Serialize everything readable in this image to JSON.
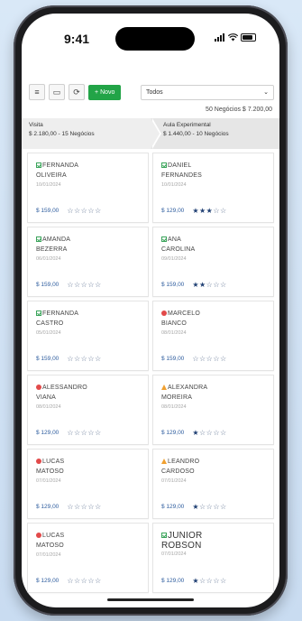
{
  "status_bar": {
    "time": "9:41"
  },
  "toolbar": {
    "icons": [
      "menu-icon",
      "window-icon",
      "refresh-icon"
    ],
    "novo_label": "Novo",
    "filter_value": "Todos"
  },
  "summary": "50 Negócios  $ 7.200,00",
  "stages": [
    {
      "title": "Visita",
      "detail": "$ 2.180,00 - 15 Negócios"
    },
    {
      "title": "Aula Experimental",
      "detail": "$ 1.440,00 - 10 Negócios"
    }
  ],
  "columns": [
    [
      {
        "icon": "check-icon",
        "first": "FERNANDA",
        "last": "OLIVEIRA",
        "date": "10/01/2024",
        "price": "$ 159,00",
        "rating": 0
      },
      {
        "icon": "check-icon",
        "first": "AMANDA",
        "last": "BEZERRA",
        "date": "06/01/2024",
        "price": "$ 159,00",
        "rating": 0
      },
      {
        "icon": "check-icon",
        "first": "FERNANDA",
        "last": "CASTRO",
        "date": "05/01/2024",
        "price": "$ 159,00",
        "rating": 0
      },
      {
        "icon": "alert-icon",
        "first": "ALESSANDRO",
        "last": "VIANA",
        "date": "08/01/2024",
        "price": "$ 129,00",
        "rating": 0
      },
      {
        "icon": "alert-icon",
        "first": "LUCAS",
        "last": "MATOSO",
        "date": "07/01/2024",
        "price": "$ 129,00",
        "rating": 0
      },
      {
        "icon": "alert-icon",
        "first": "LUCAS",
        "last": "MATOSO",
        "date": "07/01/2024",
        "price": "$ 129,00",
        "rating": 0
      }
    ],
    [
      {
        "icon": "check-icon",
        "first": "DANIEL",
        "last": "FERNANDES",
        "date": "10/01/2024",
        "price": "$ 129,00",
        "rating": 3
      },
      {
        "icon": "check-icon",
        "first": "ANA",
        "last": "CAROLINA",
        "date": "09/01/2024",
        "price": "$ 159,00",
        "rating": 2
      },
      {
        "icon": "alert-icon",
        "first": "MARCELO",
        "last": "BIANCO",
        "date": "08/01/2024",
        "price": "$ 159,00",
        "rating": 0
      },
      {
        "icon": "warning-icon",
        "first": "ALEXANDRA",
        "last": "MOREIRA",
        "date": "08/01/2024",
        "price": "$ 129,00",
        "rating": 1
      },
      {
        "icon": "warning-icon",
        "first": "LEANDRO",
        "last": "CARDOSO",
        "date": "07/01/2024",
        "price": "$ 129,00",
        "rating": 1
      },
      {
        "icon": "check-icon",
        "first": "JUNIOR",
        "last": "ROBSON",
        "date": "07/01/2024",
        "price": "$ 129,00",
        "rating": 1,
        "large": true
      }
    ]
  ]
}
